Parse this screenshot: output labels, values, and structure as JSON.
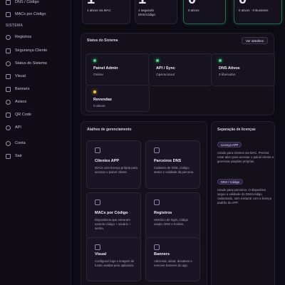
{
  "sidebar": {
    "top_items": [
      {
        "label": "DNS / Código",
        "icon": "dns-icon"
      },
      {
        "label": "MACs por Código",
        "icon": "list-icon"
      }
    ],
    "section_label": "SISTEMA",
    "items": [
      {
        "label": "Registros",
        "icon": "records-icon"
      },
      {
        "label": "Segurança Cliente",
        "icon": "shield-icon"
      },
      {
        "label": "Status do Sistema",
        "icon": "status-icon"
      },
      {
        "label": "Visual",
        "icon": "palette-icon"
      },
      {
        "label": "Banners",
        "icon": "banner-icon"
      },
      {
        "label": "Avisos",
        "icon": "bell-icon"
      },
      {
        "label": "QR Code",
        "icon": "qrcode-icon"
      },
      {
        "label": "API",
        "icon": "api-icon"
      }
    ],
    "bottom_items": [
      {
        "label": "Conta",
        "icon": "user-icon"
      },
      {
        "label": "Sair",
        "icon": "logout-icon"
      }
    ]
  },
  "stats": [
    {
      "value": "1",
      "caption": "1 ativos via MAC"
    },
    {
      "value": "1",
      "caption": "1 seguindo DNS/código"
    },
    {
      "value": "0",
      "caption": "0 ativos"
    },
    {
      "value": "0",
      "caption": "0 ativos · 0 Business"
    }
  ],
  "status_panel": {
    "title": "Status do Sistema",
    "button": "Ver detalhes",
    "cards": [
      {
        "name": "Painel Admin",
        "value": "Online",
        "dot_color": "#3ddc84"
      },
      {
        "name": "API / Sync",
        "value": "Operacional",
        "dot_color": "#3ddc84"
      },
      {
        "name": "DNS Ativos",
        "value": "0 liberados",
        "dot_color": "#3ddc84"
      },
      {
        "name": "Revendas",
        "value": "0 ativos",
        "dot_color": "#f0c93a"
      }
    ]
  },
  "shortcuts": {
    "title": "Atalhos de gerenciamento",
    "tiles": [
      {
        "name": "Clientes APP",
        "desc": "MACs com licença própria para acessar o painel cliente.",
        "icon": "clients-icon"
      },
      {
        "name": "Parceiros DNS",
        "desc": "Cadastro de DNS, código, status e validade da parceria.",
        "icon": "partners-icon"
      },
      {
        "name": "MACs por Código",
        "desc": "Dispositivos que entraram usando código + usuário + senha.",
        "icon": "devices-icon"
      },
      {
        "name": "Registros",
        "desc": "Histórico de login, código usado, DNS e horário.",
        "icon": "history-icon"
      },
      {
        "name": "Visual",
        "desc": "Configurar logo e imagem de fundo usadas pelo aplicativo.",
        "icon": "visual-icon"
      },
      {
        "name": "Banners",
        "desc": "Adicionar, ativar, desativar e remover banners do app.",
        "icon": "banners-icon"
      }
    ]
  },
  "licenses": {
    "title": "Separação de licenças",
    "blocks": [
      {
        "badge": "Licença APP",
        "text": "Usado para clientes via MAC. Precisa estar ativo para acessar o painel cliente e gerenciar playlists próprias."
      },
      {
        "badge": "DNS / Código",
        "text": "Usado para parceiros. O dispositivo segue a validade do DNS/código cadastrado, sem misturar com a licença padrão do APP."
      }
    ]
  }
}
